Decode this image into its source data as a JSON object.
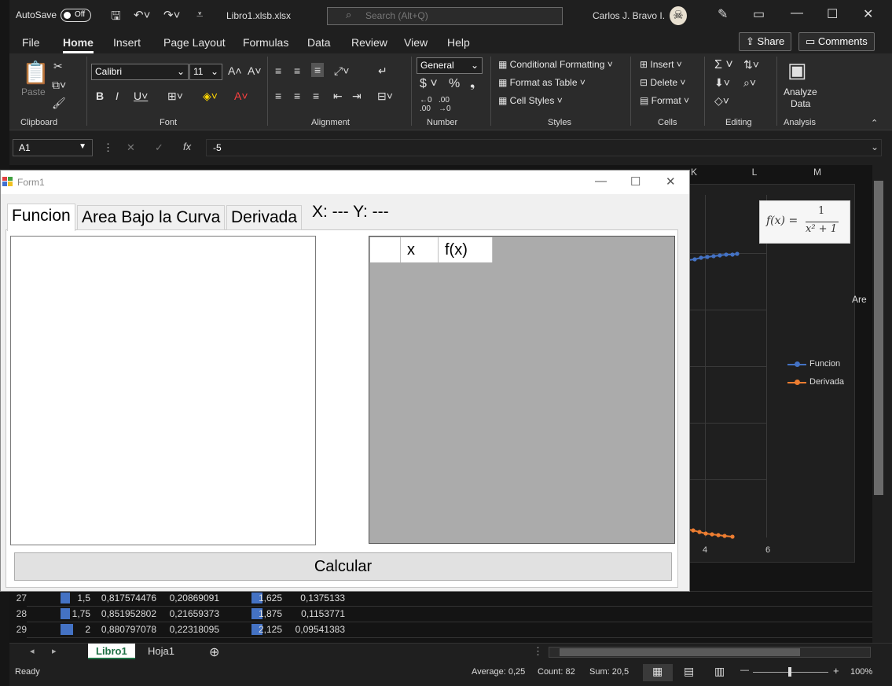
{
  "window": {
    "autosave_label": "AutoSave",
    "autosave_state": "Off",
    "doc_title": "Libro1.xlsb.xlsx",
    "search_placeholder": "Search (Alt+Q)",
    "user_name": "Carlos J. Bravo I."
  },
  "menu": {
    "items": [
      "File",
      "Home",
      "Insert",
      "Page Layout",
      "Formulas",
      "Data",
      "Review",
      "View",
      "Help"
    ],
    "share": "Share",
    "comments": "Comments"
  },
  "ribbon": {
    "paste": "Paste",
    "font_name": "Calibri",
    "font_size": "11",
    "number_format": "General",
    "conditional_formatting": "Conditional Formatting",
    "format_as_table": "Format as Table",
    "cell_styles": "Cell Styles",
    "insert": "Insert",
    "delete": "Delete",
    "format": "Format",
    "analyze_data_1": "Analyze",
    "analyze_data_2": "Data",
    "groups": [
      "Clipboard",
      "Font",
      "Alignment",
      "Number",
      "Styles",
      "Cells",
      "Editing",
      "Analysis"
    ]
  },
  "formula_bar": {
    "name_box": "A1",
    "formula": "-5"
  },
  "grid": {
    "column_headers": [
      "K",
      "L",
      "M"
    ],
    "rows": [
      {
        "num": "27",
        "a": "1,5",
        "b": "0,817574476",
        "c": "0,20869091",
        "e": "1,625",
        "f": "0,1375133"
      },
      {
        "num": "28",
        "a": "1,75",
        "b": "0,851952802",
        "c": "0,21659373",
        "e": "1,875",
        "f": "0,1153771"
      },
      {
        "num": "29",
        "a": "2",
        "b": "0,880797078",
        "c": "0,22318095",
        "e": "2,125",
        "f": "0,09541383"
      }
    ]
  },
  "chart": {
    "axis_ticks": [
      "4",
      "6"
    ],
    "legend": [
      "Funcion",
      "Derivada"
    ],
    "side_label": "Are",
    "equation_numerator": "1",
    "equation_lhs": "f(x) =",
    "equation_denominator": "x² + 1",
    "colors": {
      "funcion": "#4472c4",
      "derivada": "#ed7d31"
    }
  },
  "sheets": {
    "tabs": [
      "Libro1",
      "Hoja1"
    ]
  },
  "status": {
    "ready": "Ready",
    "average": "Average: 0,25",
    "count": "Count: 82",
    "sum": "Sum: 20,5",
    "zoom": "100%"
  },
  "form1": {
    "title": "Form1",
    "tabs": [
      "Funcion",
      "Area Bajo la Curva",
      "Derivada"
    ],
    "coords": "X: --- Y: ---",
    "grid_headers": [
      "x",
      "f(x)"
    ],
    "calc_button": "Calcular"
  }
}
